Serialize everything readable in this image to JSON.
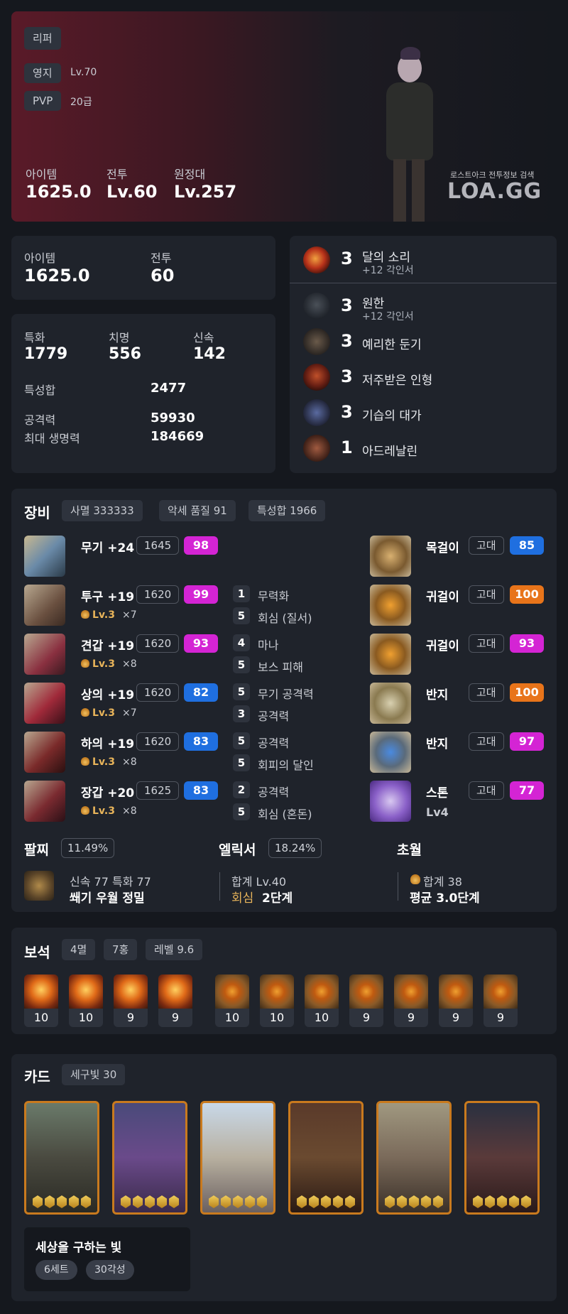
{
  "header": {
    "class_name": "리퍼",
    "stronghold_label": "영지",
    "stronghold_value": "Lv.70",
    "pvp_label": "PVP",
    "pvp_value": "20급",
    "item_label": "아이템",
    "item_value": "1625.0",
    "combat_label": "전투",
    "combat_value": "Lv.60",
    "expedition_label": "원정대",
    "expedition_value": "Lv.257",
    "watermark_small": "로스트아크 전투정보 검색",
    "watermark_logo": "LOA.GG"
  },
  "summary": {
    "item_label": "아이템",
    "item_value": "1625.0",
    "combat_label": "전투",
    "combat_value": "60"
  },
  "stats": {
    "spec_label": "특화",
    "spec_value": "1779",
    "crit_label": "치명",
    "crit_value": "556",
    "swift_label": "신속",
    "swift_value": "142",
    "total_label": "특성합",
    "total_value": "2477",
    "atk_label": "공격력",
    "atk_value": "59930",
    "hp_label": "최대 생명력",
    "hp_value": "184669"
  },
  "engravings": [
    {
      "level": "3",
      "name": "달의 소리",
      "sub": "+12 각인서",
      "icon": "moon-sound-icon"
    },
    {
      "level": "3",
      "name": "원한",
      "sub": "+12 각인서",
      "icon": "grudge-icon"
    },
    {
      "level": "3",
      "name": "예리한 둔기",
      "sub": "",
      "icon": "keen-blunt-icon"
    },
    {
      "level": "3",
      "name": "저주받은 인형",
      "sub": "",
      "icon": "cursed-doll-icon"
    },
    {
      "level": "3",
      "name": "기습의 대가",
      "sub": "",
      "icon": "master-ambush-icon"
    },
    {
      "level": "1",
      "name": "아드레날린",
      "sub": "",
      "icon": "adrenaline-icon"
    }
  ],
  "equipment": {
    "title": "장비",
    "chip_set": "사멸 333333",
    "chip_quality": "악세 품질 91",
    "chip_stat": "특성합 1966",
    "armor": [
      {
        "name": "무기 +24",
        "ilvl": "1645",
        "quality": "98",
        "qcolor": "#d424d4",
        "elixir": "",
        "count": "",
        "opts": []
      },
      {
        "name": "투구 +19",
        "ilvl": "1620",
        "quality": "99",
        "qcolor": "#d424d4",
        "elixir": "Lv.3",
        "count": "×7",
        "opts": [
          {
            "n": "1",
            "t": "무력화"
          },
          {
            "n": "5",
            "t": "회심 (질서)"
          }
        ]
      },
      {
        "name": "견갑 +19",
        "ilvl": "1620",
        "quality": "93",
        "qcolor": "#d424d4",
        "elixir": "Lv.3",
        "count": "×8",
        "opts": [
          {
            "n": "4",
            "t": "마나"
          },
          {
            "n": "5",
            "t": "보스 피해"
          }
        ]
      },
      {
        "name": "상의 +19",
        "ilvl": "1620",
        "quality": "82",
        "qcolor": "#1f6fe0",
        "elixir": "Lv.3",
        "count": "×7",
        "opts": [
          {
            "n": "5",
            "t": "무기 공격력"
          },
          {
            "n": "3",
            "t": "공격력"
          }
        ]
      },
      {
        "name": "하의 +19",
        "ilvl": "1620",
        "quality": "83",
        "qcolor": "#1f6fe0",
        "elixir": "Lv.3",
        "count": "×8",
        "opts": [
          {
            "n": "5",
            "t": "공격력"
          },
          {
            "n": "5",
            "t": "회피의 달인"
          }
        ]
      },
      {
        "name": "장갑 +20",
        "ilvl": "1625",
        "quality": "83",
        "qcolor": "#1f6fe0",
        "elixir": "Lv.3",
        "count": "×8",
        "opts": [
          {
            "n": "2",
            "t": "공격력"
          },
          {
            "n": "5",
            "t": "회심 (혼돈)"
          }
        ]
      }
    ],
    "accessories": [
      {
        "name": "목걸이",
        "tier": "고대",
        "quality": "85",
        "qcolor": "#1f6fe0"
      },
      {
        "name": "귀걸이",
        "tier": "고대",
        "quality": "100",
        "qcolor": "#e8741a"
      },
      {
        "name": "귀걸이",
        "tier": "고대",
        "quality": "93",
        "qcolor": "#d424d4"
      },
      {
        "name": "반지",
        "tier": "고대",
        "quality": "100",
        "qcolor": "#e8741a"
      },
      {
        "name": "반지",
        "tier": "고대",
        "quality": "97",
        "qcolor": "#d424d4"
      },
      {
        "name": "스톤",
        "tier": "고대",
        "quality": "77",
        "qcolor": "#d424d4",
        "sub": "Lv4"
      }
    ],
    "bracelet_label": "팔찌",
    "bracelet_pct": "11.49%",
    "bracelet_stats": "신속 77  특화 77",
    "bracelet_effects": "쐐기  우월  정밀",
    "elixir_label": "엘릭서",
    "elixir_pct": "18.24%",
    "elixir_total": "합계 Lv.40",
    "elixir_set_key": "회심",
    "elixir_set_val": "2단계",
    "transcend_label": "초월",
    "transcend_total": "합계 38",
    "transcend_avg": "평균 3.0단계"
  },
  "gems": {
    "title": "보석",
    "chip_a": "4멸",
    "chip_b": "7홍",
    "chip_c": "레벨 9.6",
    "dmg": [
      "10",
      "10",
      "9",
      "9"
    ],
    "cd": [
      "10",
      "10",
      "10",
      "9",
      "9",
      "9",
      "9"
    ]
  },
  "cards": {
    "title": "카드",
    "chip": "세구빛 30",
    "set_name": "세상을 구하는 빛",
    "set_count": "6세트",
    "set_awake": "30각성"
  }
}
